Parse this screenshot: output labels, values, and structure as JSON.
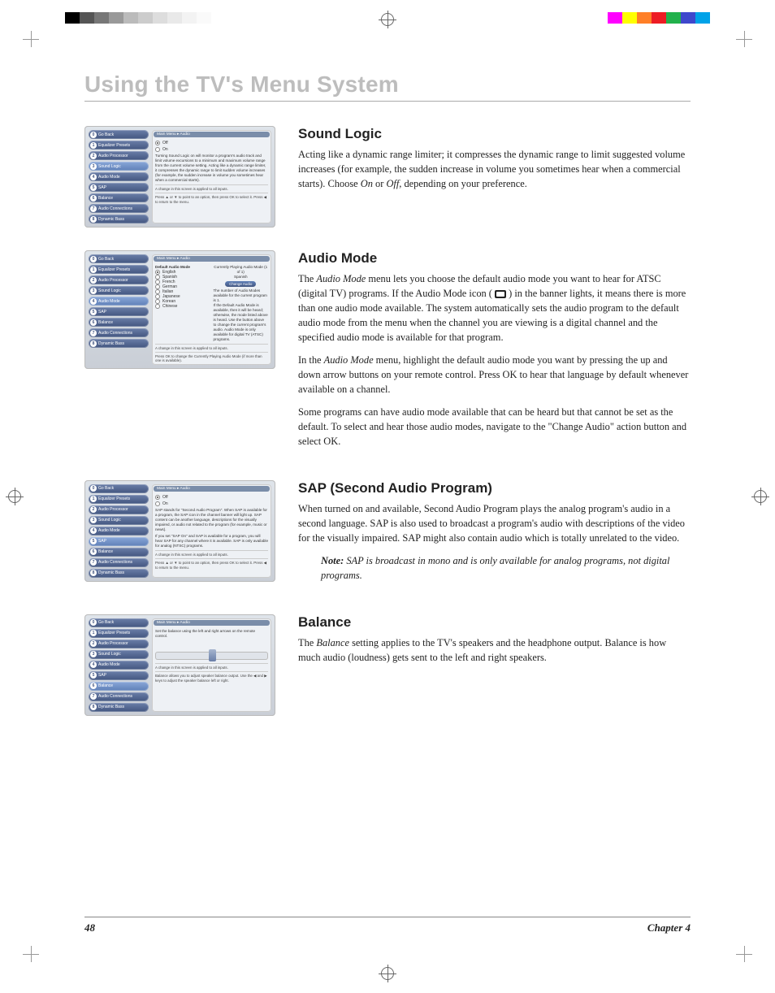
{
  "chapter_title": "Using the TV's Menu System",
  "footer": {
    "page": "48",
    "chapter": "Chapter 4"
  },
  "sections": {
    "sound_logic": {
      "heading": "Sound Logic",
      "para1a": "Acting like a dynamic range limiter; it compresses the dynamic range to limit suggested volume increases (for example, the sudden increase in volume you sometimes hear when a commercial starts). Choose ",
      "on": "On",
      "mid": " or ",
      "off": "Off,",
      "para1b": " depending on your preference."
    },
    "audio_mode": {
      "heading": "Audio Mode",
      "p1a": "The ",
      "p1em": "Audio Mode",
      "p1b": " menu lets you choose the default audio mode you want to hear for ATSC (digital TV) programs. If the Audio Mode icon ( ",
      "p1c": " ) in the banner lights, it means there is more than one audio mode available. The system automatically sets the audio program to the default audio mode from the menu when the channel you are viewing is a digital channel and the specified audio mode is available for that program.",
      "p2a": "In the ",
      "p2em": "Audio Mode",
      "p2b": " menu, highlight the default audio mode you want by pressing the up and down arrow buttons on your remote control. Press OK to hear that language by default whenever available on a channel.",
      "p3": "Some programs can have audio mode available that can be heard but that cannot be set as the default. To select and hear those audio modes, navigate to the \"Change Audio\" action button and select OK."
    },
    "sap": {
      "heading": "SAP (Second Audio Program)",
      "p1": "When turned on and available, Second Audio Program plays the analog program's audio in a second language. SAP is also used to broadcast a program's audio with descriptions of the video for the visually impaired. SAP might also contain audio which is totally unrelated to the video.",
      "note_label": "Note:",
      "note_text": " SAP is broadcast in mono and is only available for analog programs, not digital programs."
    },
    "balance": {
      "heading": "Balance",
      "p1a": "The ",
      "p1em": "Balance",
      "p1b": " setting applies to the TV's speakers and the headphone output. Balance is how much audio (loudness) gets sent to the left and right speakers."
    }
  },
  "menus": {
    "breadcrumb": "Main Menu ▸ Audio",
    "side_items": {
      "i0": "Go Back",
      "i1": "Equalizer Presets",
      "i2": "Audio Processor",
      "i3": "Sound Logic",
      "i4": "Audio Mode",
      "i5": "SAP",
      "i6": "Balance",
      "i7": "Audio Connections",
      "i8": "Dynamic Bass"
    },
    "sound_logic_panel": {
      "opt_off": "Off",
      "opt_on": "On",
      "desc": "Turning Sound Logic on will monitor a program's audio track and limit volume excursions to a minimum and maximum volume range from the current volume setting. Acting like a dynamic range limiter, it compresses the dynamic range to limit sudden volume increases (for example, the sudden increase in volume you sometimes hear when a commercial starts).",
      "applied": "A change in this screen is applied to all inputs.",
      "help": "Press ▲ or ▼ to point to an option, then press OK to select it. Press ◀ to return to the menu."
    },
    "audio_mode_panel": {
      "label_default": "Default Audio Mode",
      "label_current_h": "Currently Playing Audio Mode (1 of 1)",
      "label_current_v": "Spanish",
      "btn": "Change Audio",
      "langs": {
        "l1": "English",
        "l2": "Spanish",
        "l3": "French",
        "l4": "German",
        "l5": "Italian",
        "l6": "Japanese",
        "l7": "Korean",
        "l8": "Chinese"
      },
      "desc1": "The number of Audio Modes available for the current program is 1.",
      "desc2": "If the Default Audio Mode is available, then it will be heard; otherwise, the mode listed above is heard. Use the button above to change the current program's audio. Audio Mode is only available for digital TV (ATSC) programs.",
      "applied": "A change in this screen is applied to all inputs.",
      "help": "Press OK to change the Currently Playing Audio Mode (if more than one is available)."
    },
    "sap_panel": {
      "opt_off": "Off",
      "opt_on": "On",
      "desc1": "SAP stands for \"Second Audio Program\". When SAP is available for a program, the SAP icon in the channel banner will light up. SAP content can be another language, descriptions for the visually impaired, or audio not related to the program (for example, music or news).",
      "desc2": "If you set \"SAP On\" and SAP is available for a program, you will hear SAP for any channel where it is available. SAP is only available for analog (NTSC) programs.",
      "applied": "A change in this screen is applied to all inputs.",
      "help": "Press ▲ or ▼ to point to an option, then press OK to select it. Press ◀ to return to the menu."
    },
    "balance_panel": {
      "desc": "Set the balance using the left and right arrows on the remote control.",
      "applied": "A change in this screen is applied to all inputs.",
      "help": "Balance allows you to adjust speaker balance output. Use the ◀ and ▶ keys to adjust the speaker balance left or right."
    }
  }
}
